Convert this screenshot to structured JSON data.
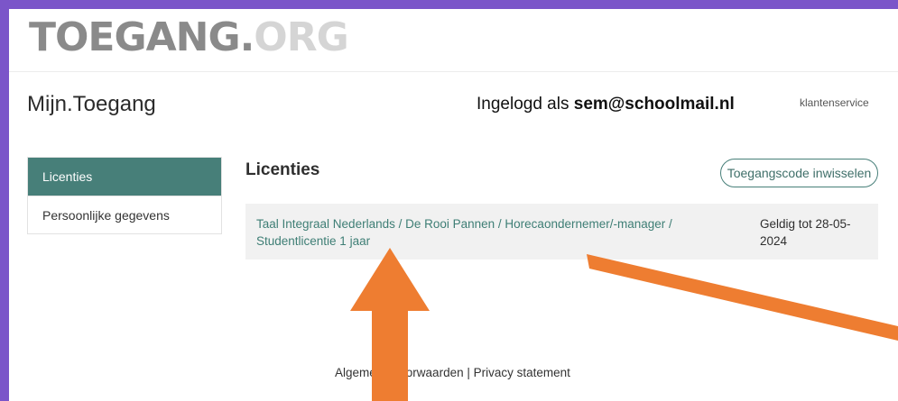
{
  "logo": {
    "part1": "TOEGANG.",
    "part2": "ORG"
  },
  "header": {
    "app_title": "Mijn.Toegang",
    "logged_in_prefix": "Ingelogd als",
    "user_email": "sem@schoolmail.nl",
    "service_link": "klantenservice"
  },
  "sidebar": {
    "items": [
      {
        "label": "Licenties",
        "active": true
      },
      {
        "label": "Persoonlijke gegevens",
        "active": false
      }
    ]
  },
  "main": {
    "title": "Licenties",
    "redeem_button": "Toegangscode inwisselen",
    "licenses": [
      {
        "name_line1": "Taal Integraal Nederlands / De Rooi Pannen / Horecaondernemer/-manager /",
        "name_line2": "Studentlicentie 1 jaar",
        "valid_line1": "Geldig tot 28-05-",
        "valid_line2": "2024"
      }
    ]
  },
  "footer": {
    "terms_link": "Algemene voorwaarden",
    "separator": "|",
    "privacy_link": "Privacy statement"
  },
  "colors": {
    "frame": "#7b55c9",
    "accent": "#477f79",
    "link": "#3e7e75",
    "annotation_arrow": "#ee7d31"
  }
}
